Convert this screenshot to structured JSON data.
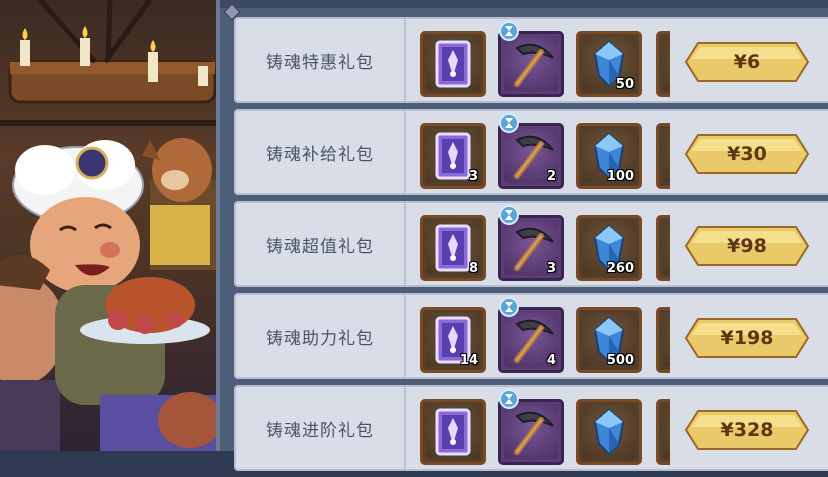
{
  "packs": [
    {
      "title": "铸魂特惠礼包",
      "items": [
        {
          "icon": "soul-card-icon",
          "count": ""
        },
        {
          "icon": "pickaxe-icon",
          "count": ""
        },
        {
          "icon": "blue-crystal-icon",
          "count": "50"
        }
      ],
      "price": "¥6"
    },
    {
      "title": "铸魂补给礼包",
      "items": [
        {
          "icon": "soul-card-icon",
          "count": "3"
        },
        {
          "icon": "pickaxe-icon",
          "count": "2"
        },
        {
          "icon": "blue-crystal-icon",
          "count": "100"
        }
      ],
      "price": "¥30"
    },
    {
      "title": "铸魂超值礼包",
      "items": [
        {
          "icon": "soul-card-icon",
          "count": "8"
        },
        {
          "icon": "pickaxe-icon",
          "count": "3"
        },
        {
          "icon": "blue-crystal-icon",
          "count": "260"
        }
      ],
      "price": "¥98"
    },
    {
      "title": "铸魂助力礼包",
      "items": [
        {
          "icon": "soul-card-icon",
          "count": "14"
        },
        {
          "icon": "pickaxe-icon",
          "count": "4"
        },
        {
          "icon": "blue-crystal-icon",
          "count": "500"
        }
      ],
      "price": "¥198"
    },
    {
      "title": "铸魂进阶礼包",
      "items": [
        {
          "icon": "soul-card-icon",
          "count": ""
        },
        {
          "icon": "pickaxe-icon",
          "count": ""
        },
        {
          "icon": "blue-crystal-icon",
          "count": ""
        }
      ],
      "price": "¥328"
    }
  ],
  "colors": {
    "panel": "#4f5e78",
    "row": "#d8dde7",
    "title_text": "#4c5568",
    "price_button": "#e9c96a",
    "price_text": "#5a3712",
    "purple_slot": "#5b3d74",
    "brown_slot": "#56402c"
  }
}
